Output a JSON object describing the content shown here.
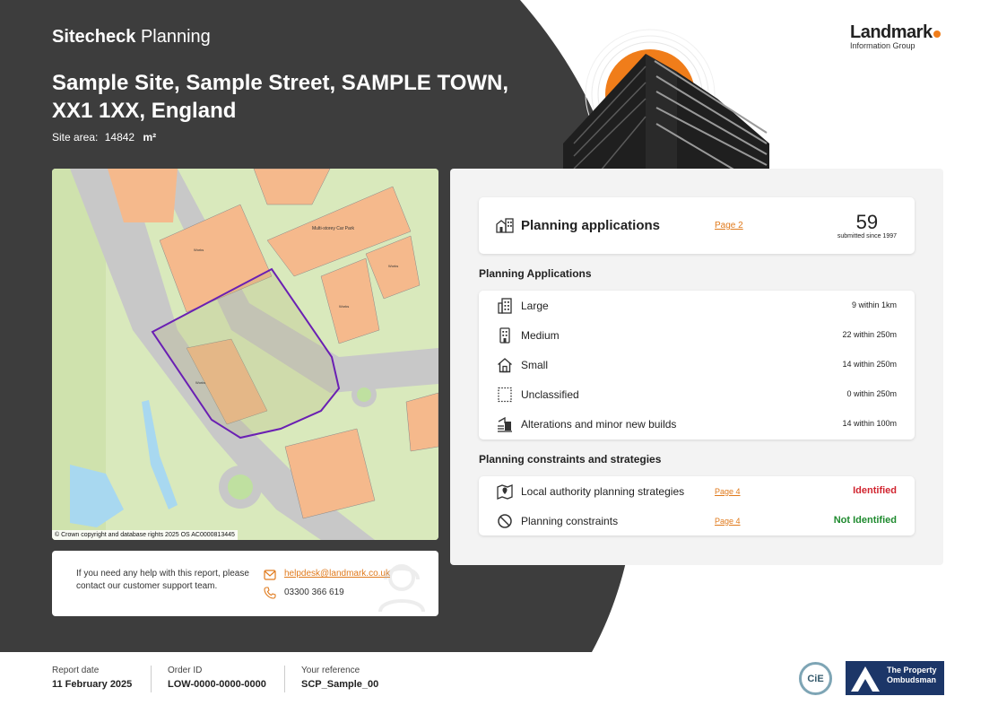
{
  "header": {
    "brand_bold": "Sitecheck",
    "brand_light": "Planning",
    "site_title": "Sample Site, Sample Street, SAMPLE TOWN, XX1 1XX, England",
    "site_area_label": "Site area:",
    "site_area_value": "14842",
    "site_area_unit": "m²"
  },
  "logo": {
    "name": "Landmark",
    "subtitle": "Information Group"
  },
  "map": {
    "credit": "© Crown copyright and database rights 2025 OS AC0000813445",
    "labels": [
      "Multi-storey Car Park",
      "Works",
      "Hotel",
      "Works",
      "Works",
      "Works"
    ]
  },
  "help": {
    "text": "If you need any help with this report, please contact our customer support team.",
    "email": "helpdesk@landmark.co.uk",
    "phone": "03300 366 619"
  },
  "planning_applications": {
    "title": "Planning applications",
    "link": "Page 2",
    "count": "59",
    "count_label": "submitted since 1997"
  },
  "applications_section": {
    "title": "Planning Applications",
    "rows": [
      {
        "label": "Large",
        "value": "9 within 1km",
        "icon": "building-large-icon"
      },
      {
        "label": "Medium",
        "value": "22 within 250m",
        "icon": "building-medium-icon"
      },
      {
        "label": "Small",
        "value": "14 within 250m",
        "icon": "house-icon"
      },
      {
        "label": "Unclassified",
        "value": "0 within 250m",
        "icon": "dotted-square-icon"
      },
      {
        "label": "Alterations and minor new builds",
        "value": "14 within 100m",
        "icon": "alterations-icon"
      }
    ]
  },
  "constraints_section": {
    "title": "Planning constraints and strategies",
    "rows": [
      {
        "label": "Local authority planning strategies",
        "link": "Page 4",
        "status": "Identified",
        "status_color": "#d1242f",
        "icon": "map-pin-icon"
      },
      {
        "label": "Planning constraints",
        "link": "Page 4",
        "status": "Not Identified",
        "status_color": "#1e8a2e",
        "icon": "no-entry-icon"
      }
    ]
  },
  "footer": {
    "report_date_label": "Report date",
    "report_date": "11 February 2025",
    "order_id_label": "Order ID",
    "order_id": "LOW-0000-0000-0000",
    "reference_label": "Your reference",
    "reference": "SCP_Sample_00",
    "cie": "CiE",
    "ombudsman": "The Property Ombudsman"
  },
  "colors": {
    "dark_bg": "#3d3d3d",
    "accent": "#f07d1a",
    "identified": "#d1242f",
    "not_identified": "#1e8a2e"
  }
}
